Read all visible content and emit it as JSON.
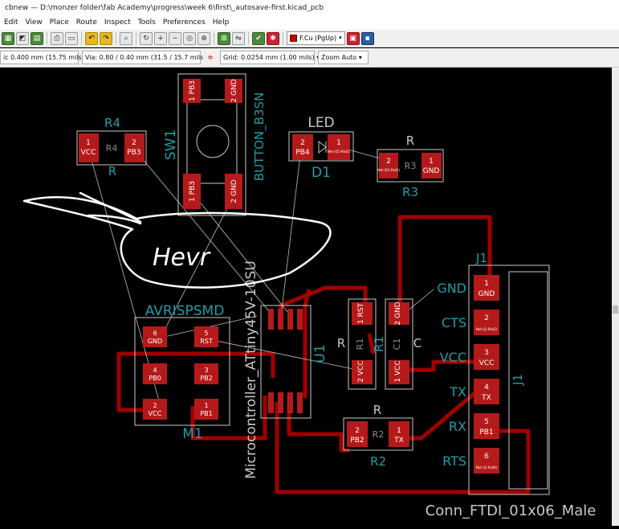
{
  "window": {
    "title": "cbnew — D:\\monzer folder\\fab Academy\\progress\\week 6\\first\\_autosave-first.kicad_pcb"
  },
  "menu": [
    "Edit",
    "View",
    "Place",
    "Route",
    "Inspect",
    "Tools",
    "Preferences",
    "Help"
  ],
  "toolbar": {
    "layer_select": "F.Cu (PgUp)"
  },
  "options": {
    "track": "ic 0.400 mm (15.75 mils) *",
    "via": "Via: 0.80 / 0.40 mm (31.5 / 15.7 mils) *",
    "grid": "Grid: 0.0254 mm (1.00 mils)",
    "zoom": "Zoom Auto"
  },
  "colors": {
    "copper": "#a00000",
    "pad": "#b51a1a",
    "silk": "#1e9ea8",
    "outline": "#c8c8c8",
    "ratsnest": "#bfbfbf"
  },
  "pcb": {
    "R4": {
      "ref": "R4",
      "value": "R",
      "pad1": "1",
      "pad1_net": "VCC",
      "pad2": "2",
      "pad2_net": "PB3",
      "inner": "R4"
    },
    "SW1": {
      "ref": "SW1",
      "value": "BUTTON_B3SN",
      "p1": "1",
      "p1_net": "PB3",
      "p2": "2",
      "p2_net": "GND",
      "p3": "1",
      "p3_net": "PB3",
      "p4": "2",
      "p4_net": "GND"
    },
    "D1": {
      "ref": "D1",
      "value": "LED",
      "pad1": "1",
      "pad1_net": "Net-(D1-Pad1)",
      "pad2": "2",
      "pad2_net": "PB4"
    },
    "R3": {
      "ref": "R3",
      "value": "R",
      "pad1": "1",
      "pad1_net": "GND",
      "pad2": "2",
      "pad2_net": "Net-(D1-Pad1)",
      "inner": "R3"
    },
    "J1": {
      "ref": "J1",
      "value": "Conn_FTDI_01x06_Male",
      "labels": [
        "GND",
        "CTS",
        "VCC",
        "TX",
        "RX",
        "RTS"
      ],
      "pins": [
        {
          "num": "1",
          "net": "GND"
        },
        {
          "num": "2",
          "net": "Net-(J1-Pad2)"
        },
        {
          "num": "3",
          "net": "VCC"
        },
        {
          "num": "4",
          "net": "TX"
        },
        {
          "num": "5",
          "net": "PB1"
        },
        {
          "num": "6",
          "net": "Net-(J1-Pad6)"
        }
      ]
    },
    "AVR": {
      "ref": "AVRISPSMD",
      "ref_m": "M1",
      "pads": [
        {
          "num": "6",
          "net": "GND"
        },
        {
          "num": "5",
          "net": "RST"
        },
        {
          "num": "4",
          "net": "PB0"
        },
        {
          "num": "3",
          "net": "PB2"
        },
        {
          "num": "2",
          "net": "VCC"
        },
        {
          "num": "1",
          "net": "PB1"
        }
      ]
    },
    "U1": {
      "ref": "U1",
      "value": "Microcontroller_ATtiny45V-10SU"
    },
    "R1": {
      "ref": "R1",
      "value": "R",
      "inner": "R1",
      "pad1": "1",
      "pad1_net": "RST",
      "pad2": "2",
      "pad2_net": "VCC"
    },
    "C1": {
      "ref": "C1",
      "value": "C",
      "inner": "C1",
      "pad1": "1",
      "pad1_net": "VCC",
      "pad2": "2",
      "pad2_net": "GND"
    },
    "R2": {
      "ref": "R2",
      "value": "R",
      "inner": "R2",
      "pad1": "1",
      "pad1_net": "TX",
      "pad2": "2",
      "pad2_net": "PB2"
    },
    "hover_text": "Hevr"
  }
}
